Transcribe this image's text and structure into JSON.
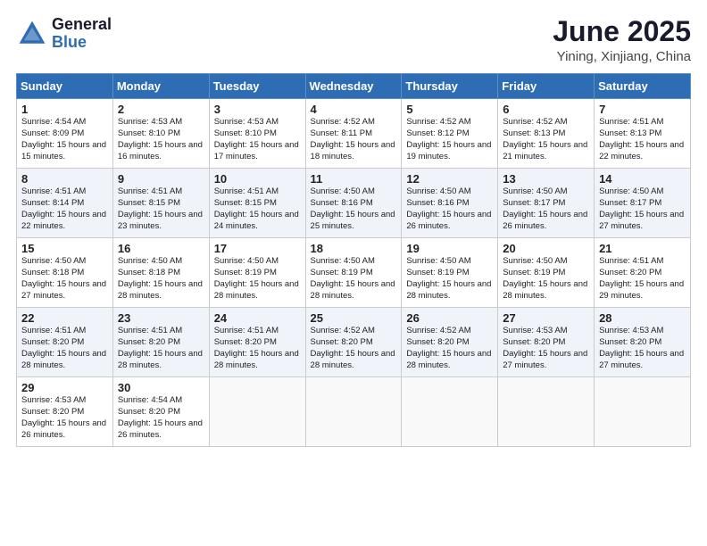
{
  "header": {
    "logo_general": "General",
    "logo_blue": "Blue",
    "title": "June 2025",
    "subtitle": "Yining, Xinjiang, China"
  },
  "weekdays": [
    "Sunday",
    "Monday",
    "Tuesday",
    "Wednesday",
    "Thursday",
    "Friday",
    "Saturday"
  ],
  "weeks": [
    [
      {
        "day": "1",
        "info": "Sunrise: 4:54 AM\nSunset: 8:09 PM\nDaylight: 15 hours and 15 minutes."
      },
      {
        "day": "2",
        "info": "Sunrise: 4:53 AM\nSunset: 8:10 PM\nDaylight: 15 hours and 16 minutes."
      },
      {
        "day": "3",
        "info": "Sunrise: 4:53 AM\nSunset: 8:10 PM\nDaylight: 15 hours and 17 minutes."
      },
      {
        "day": "4",
        "info": "Sunrise: 4:52 AM\nSunset: 8:11 PM\nDaylight: 15 hours and 18 minutes."
      },
      {
        "day": "5",
        "info": "Sunrise: 4:52 AM\nSunset: 8:12 PM\nDaylight: 15 hours and 19 minutes."
      },
      {
        "day": "6",
        "info": "Sunrise: 4:52 AM\nSunset: 8:13 PM\nDaylight: 15 hours and 21 minutes."
      },
      {
        "day": "7",
        "info": "Sunrise: 4:51 AM\nSunset: 8:13 PM\nDaylight: 15 hours and 22 minutes."
      }
    ],
    [
      {
        "day": "8",
        "info": "Sunrise: 4:51 AM\nSunset: 8:14 PM\nDaylight: 15 hours and 22 minutes."
      },
      {
        "day": "9",
        "info": "Sunrise: 4:51 AM\nSunset: 8:15 PM\nDaylight: 15 hours and 23 minutes."
      },
      {
        "day": "10",
        "info": "Sunrise: 4:51 AM\nSunset: 8:15 PM\nDaylight: 15 hours and 24 minutes."
      },
      {
        "day": "11",
        "info": "Sunrise: 4:50 AM\nSunset: 8:16 PM\nDaylight: 15 hours and 25 minutes."
      },
      {
        "day": "12",
        "info": "Sunrise: 4:50 AM\nSunset: 8:16 PM\nDaylight: 15 hours and 26 minutes."
      },
      {
        "day": "13",
        "info": "Sunrise: 4:50 AM\nSunset: 8:17 PM\nDaylight: 15 hours and 26 minutes."
      },
      {
        "day": "14",
        "info": "Sunrise: 4:50 AM\nSunset: 8:17 PM\nDaylight: 15 hours and 27 minutes."
      }
    ],
    [
      {
        "day": "15",
        "info": "Sunrise: 4:50 AM\nSunset: 8:18 PM\nDaylight: 15 hours and 27 minutes."
      },
      {
        "day": "16",
        "info": "Sunrise: 4:50 AM\nSunset: 8:18 PM\nDaylight: 15 hours and 28 minutes."
      },
      {
        "day": "17",
        "info": "Sunrise: 4:50 AM\nSunset: 8:19 PM\nDaylight: 15 hours and 28 minutes."
      },
      {
        "day": "18",
        "info": "Sunrise: 4:50 AM\nSunset: 8:19 PM\nDaylight: 15 hours and 28 minutes."
      },
      {
        "day": "19",
        "info": "Sunrise: 4:50 AM\nSunset: 8:19 PM\nDaylight: 15 hours and 28 minutes."
      },
      {
        "day": "20",
        "info": "Sunrise: 4:50 AM\nSunset: 8:19 PM\nDaylight: 15 hours and 28 minutes."
      },
      {
        "day": "21",
        "info": "Sunrise: 4:51 AM\nSunset: 8:20 PM\nDaylight: 15 hours and 29 minutes."
      }
    ],
    [
      {
        "day": "22",
        "info": "Sunrise: 4:51 AM\nSunset: 8:20 PM\nDaylight: 15 hours and 28 minutes."
      },
      {
        "day": "23",
        "info": "Sunrise: 4:51 AM\nSunset: 8:20 PM\nDaylight: 15 hours and 28 minutes."
      },
      {
        "day": "24",
        "info": "Sunrise: 4:51 AM\nSunset: 8:20 PM\nDaylight: 15 hours and 28 minutes."
      },
      {
        "day": "25",
        "info": "Sunrise: 4:52 AM\nSunset: 8:20 PM\nDaylight: 15 hours and 28 minutes."
      },
      {
        "day": "26",
        "info": "Sunrise: 4:52 AM\nSunset: 8:20 PM\nDaylight: 15 hours and 28 minutes."
      },
      {
        "day": "27",
        "info": "Sunrise: 4:53 AM\nSunset: 8:20 PM\nDaylight: 15 hours and 27 minutes."
      },
      {
        "day": "28",
        "info": "Sunrise: 4:53 AM\nSunset: 8:20 PM\nDaylight: 15 hours and 27 minutes."
      }
    ],
    [
      {
        "day": "29",
        "info": "Sunrise: 4:53 AM\nSunset: 8:20 PM\nDaylight: 15 hours and 26 minutes."
      },
      {
        "day": "30",
        "info": "Sunrise: 4:54 AM\nSunset: 8:20 PM\nDaylight: 15 hours and 26 minutes."
      },
      null,
      null,
      null,
      null,
      null
    ]
  ]
}
